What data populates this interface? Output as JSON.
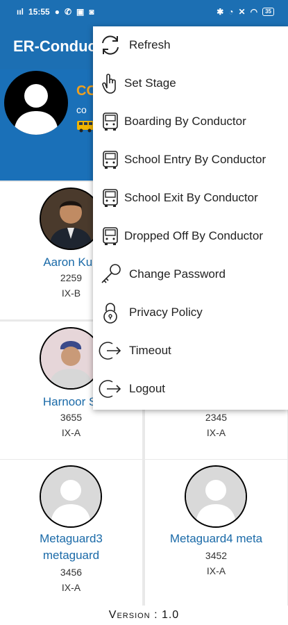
{
  "status_bar": {
    "time": "15:55",
    "signal": "ııl",
    "battery": "35"
  },
  "app_bar": {
    "title": "ER-Conductor"
  },
  "profile": {
    "name": "CO",
    "subtitle": "co"
  },
  "students": [
    {
      "name": "Aaron Kun",
      "id": "2259",
      "class": "IX-B"
    },
    {
      "name": "",
      "id": "",
      "class": ""
    },
    {
      "name": "Harnoor Si",
      "id": "3655",
      "class": "IX-A"
    },
    {
      "name": "",
      "id": "2345",
      "class": "IX-A"
    },
    {
      "name_line1": "Metaguard3",
      "name_line2": "metaguard",
      "id": "3456",
      "class": "IX-A"
    },
    {
      "name": "Metaguard4 meta",
      "id": "3452",
      "class": "IX-A"
    }
  ],
  "menu": {
    "items": [
      {
        "label": "Refresh",
        "icon": "refresh-icon"
      },
      {
        "label": "Set Stage",
        "icon": "hand-pointer-icon"
      },
      {
        "label": "Boarding By Conductor",
        "icon": "bus-icon"
      },
      {
        "label": "School Entry By Conductor",
        "icon": "bus-icon"
      },
      {
        "label": "School Exit By Conductor",
        "icon": "bus-icon"
      },
      {
        "label": "Dropped Off By Conductor",
        "icon": "bus-icon"
      },
      {
        "label": "Change Password",
        "icon": "key-icon"
      },
      {
        "label": "Privacy Policy",
        "icon": "padlock-icon"
      },
      {
        "label": "Timeout",
        "icon": "exit-icon"
      },
      {
        "label": "Logout",
        "icon": "exit-icon"
      }
    ]
  },
  "footer": {
    "version": "Version : 1.0"
  },
  "colors": {
    "primary": "#1c6fb3",
    "accent": "#f0a11f",
    "link": "#1a6aa8"
  }
}
